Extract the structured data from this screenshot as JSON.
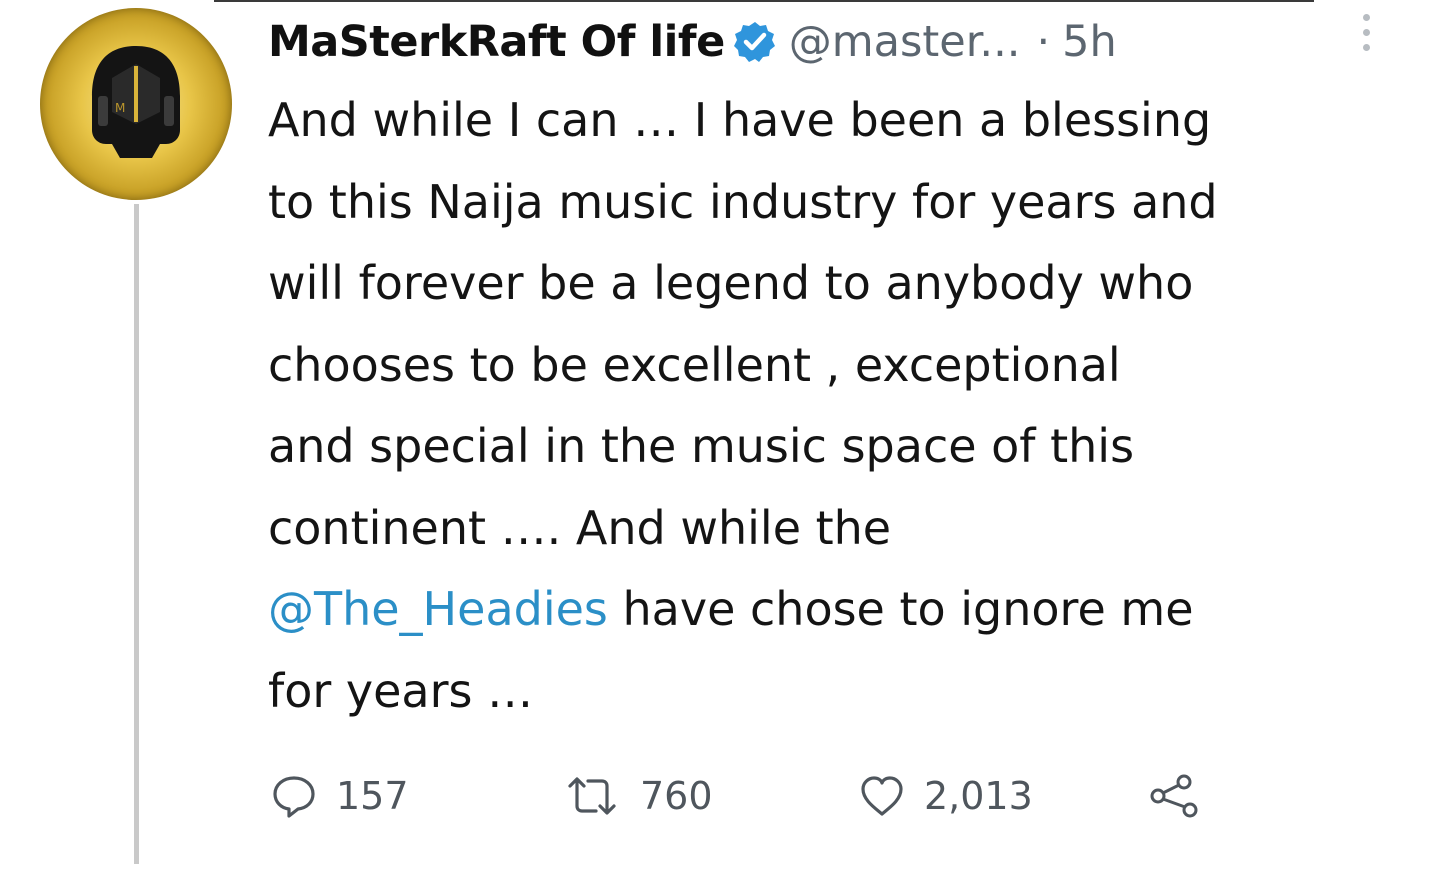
{
  "tweet": {
    "display_name": "MaSterkRaft Of life",
    "handle": "@master...",
    "separator": "·",
    "time": "5h",
    "verified": true,
    "lines": [
      {
        "text": "And while I can … I have been a blessing"
      },
      {
        "text": "to this Naija music industry for years and"
      },
      {
        "text": "will forever be a legend to anybody who"
      },
      {
        "text": "chooses to be excellent , exceptional"
      },
      {
        "text": "and special in the music space of this"
      },
      {
        "text": "continent …. And while the"
      },
      {
        "mention": "@The_Headies",
        "text": " have chose to ignore me"
      },
      {
        "text": "for years …"
      }
    ]
  },
  "actions": {
    "replies": "157",
    "retweets": "760",
    "likes": "2,013"
  },
  "icons": {
    "verified": "verified-badge-icon",
    "more": "more-options-icon",
    "reply": "reply-icon",
    "retweet": "retweet-icon",
    "like": "heart-icon",
    "share": "share-icon"
  },
  "colors": {
    "verified_blue": "#2f95dc",
    "mention_blue": "#2b8fc7",
    "secondary_text": "#5c6670",
    "avatar_gold": "#e8c548"
  }
}
